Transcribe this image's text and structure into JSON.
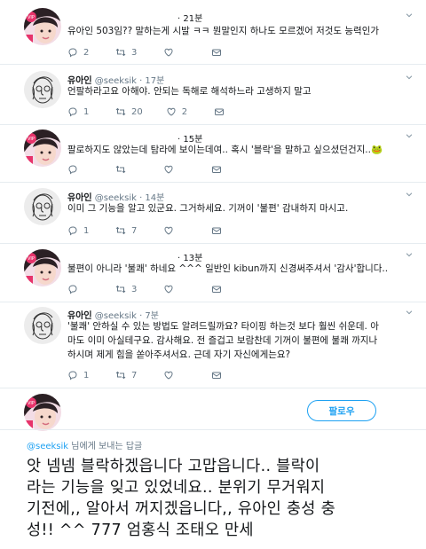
{
  "tweets": [
    {
      "time": "· 21분",
      "lines": [
        "유아인 503임?? 말하는게 시발 ㅋㅋ 뭔말인지 하나도 모르겠어 저것도 능력인가"
      ],
      "replies": "2",
      "retweets": "3",
      "likes": ""
    },
    {
      "name": "유아인",
      "handle": "@seeksik",
      "time": "· 17분",
      "lines": [
        "언팔하라고요 아해야. 안되는 독해로 해석하느라 고생하지 말고"
      ],
      "replies": "1",
      "retweets": "20",
      "likes": "2"
    },
    {
      "time": "· 15분",
      "lines": [
        "팔로하지도 않았는데 탐라에 보이는데여.. 혹시 '블락'을 말하고 싶으셨던건지..🐸"
      ],
      "replies": "",
      "retweets": "",
      "likes": ""
    },
    {
      "name": "유아인",
      "handle": "@seeksik",
      "time": "· 14분",
      "lines": [
        "이미 그 기능을 알고 있군요. 그거하세요. 기꺼이 '불편' 감내하지 마시고."
      ],
      "replies": "1",
      "retweets": "7",
      "likes": ""
    },
    {
      "time": "· 13분",
      "lines": [
        "불편이 아니라 '불쾌' 하네요 ^^^ 일반인 kibun까지 신경써주셔서 '감사'합니다.."
      ],
      "replies": "",
      "retweets": "3",
      "likes": ""
    },
    {
      "name": "유아인",
      "handle": "@seeksik",
      "time": "· 7분",
      "lines": [
        "'불쾌' 안하실 수 있는 방법도 알려드릴까요? 타이핑 하는것 보다 훨씬 쉬운데. 아",
        "마도 이미 아실테구요. 감사해요. 전 즐겁고 보람찬데 기꺼이 불편에 불쾌 까지나",
        "하시며 제게 힘을 쏟아주셔서요. 근데 자기 자신에게는요?"
      ],
      "replies": "1",
      "retweets": "7",
      "likes": ""
    }
  ],
  "follow_label": "팔로우",
  "reply_to": {
    "handle": "@seeksik",
    "suffix": " 님에게 보내는 답글"
  },
  "main_text": [
    "앗 넴넴 블락하겠읍니다 고맙읍니다.. 블락이",
    "라는 기능을 잊고 있었네요.. 분위기 무거워지",
    "기전에,, 알아서 꺼지겠읍니다,, 유아인 충성 충",
    "성!! ^^ 777 엄홍식 조태오 만세"
  ],
  "colors": {
    "accent": "#1da1f2",
    "muted": "#657786",
    "text": "#14171a",
    "divider": "#e6ecf0"
  }
}
